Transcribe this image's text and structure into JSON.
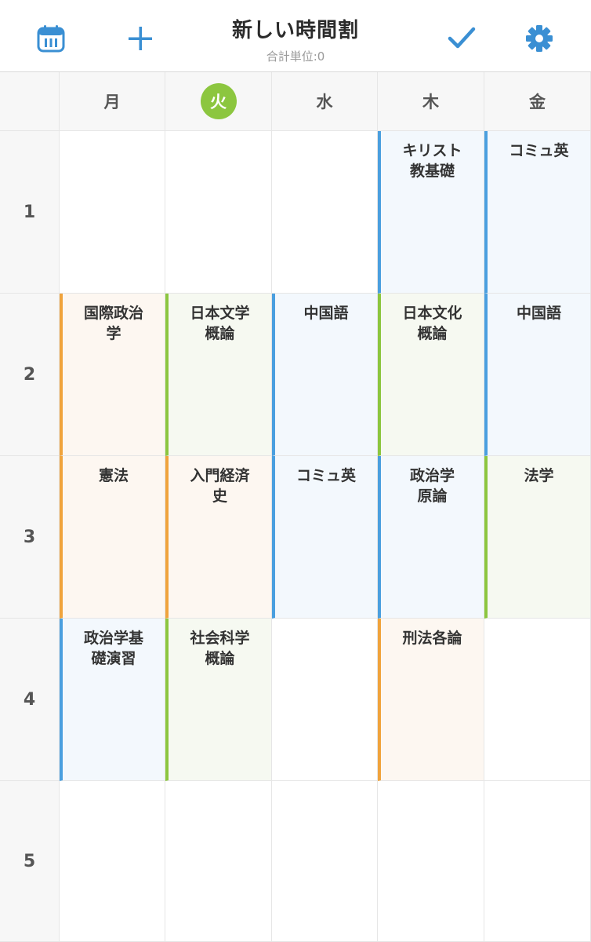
{
  "header": {
    "title": "新しい時間割",
    "subtitle": "合計単位:0",
    "icons": {
      "left1": "calendar-icon",
      "left2": "plus-icon",
      "right1": "checkmark-icon",
      "right2": "gear-icon"
    },
    "accent": "#3a8fd3"
  },
  "days": [
    "月",
    "火",
    "水",
    "木",
    "金"
  ],
  "today_index": 1,
  "periods": [
    "1",
    "2",
    "3",
    "4",
    "5"
  ],
  "colors": {
    "blue": "#4a9fdf",
    "orange": "#f0a33c",
    "green": "#8cc63f"
  },
  "courses": [
    {
      "period": 1,
      "day": 3,
      "name": "キリスト\n教基礎",
      "color": "blue"
    },
    {
      "period": 1,
      "day": 4,
      "name": "コミュ英",
      "color": "blue"
    },
    {
      "period": 2,
      "day": 0,
      "name": "国際政治\n学",
      "color": "orange"
    },
    {
      "period": 2,
      "day": 1,
      "name": "日本文学\n概論",
      "color": "green"
    },
    {
      "period": 2,
      "day": 2,
      "name": "中国語",
      "color": "blue"
    },
    {
      "period": 2,
      "day": 3,
      "name": "日本文化\n概論",
      "color": "green"
    },
    {
      "period": 2,
      "day": 4,
      "name": "中国語",
      "color": "blue"
    },
    {
      "period": 3,
      "day": 0,
      "name": "憲法",
      "color": "orange"
    },
    {
      "period": 3,
      "day": 1,
      "name": "入門経済\n史",
      "color": "orange"
    },
    {
      "period": 3,
      "day": 2,
      "name": "コミュ英",
      "color": "blue"
    },
    {
      "period": 3,
      "day": 3,
      "name": "政治学\n原論",
      "color": "blue"
    },
    {
      "period": 3,
      "day": 4,
      "name": "法学",
      "color": "green"
    },
    {
      "period": 4,
      "day": 0,
      "name": "政治学基\n礎演習",
      "color": "blue"
    },
    {
      "period": 4,
      "day": 1,
      "name": "社会科学\n概論",
      "color": "green"
    },
    {
      "period": 4,
      "day": 3,
      "name": "刑法各論",
      "color": "orange"
    }
  ]
}
